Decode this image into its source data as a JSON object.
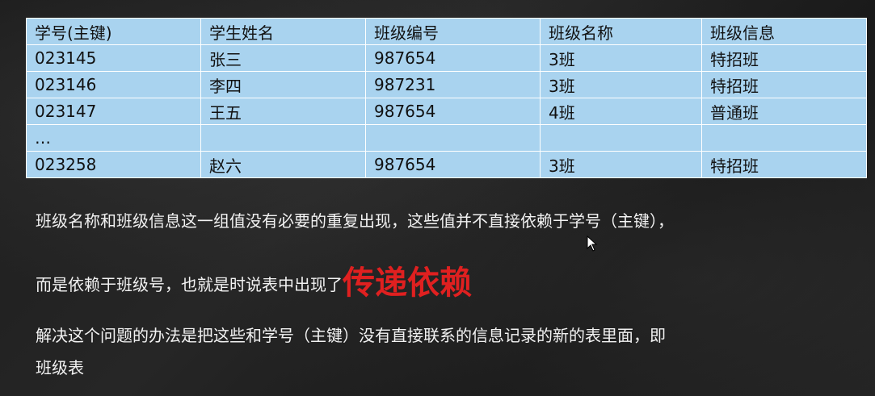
{
  "table": {
    "headers": [
      "学号(主键)",
      "学生姓名",
      "班级编号",
      "班级名称",
      "班级信息"
    ],
    "rows": [
      [
        "023145",
        "张三",
        "987654",
        "3班",
        "特招班"
      ],
      [
        "023146",
        "李四",
        "987231",
        "3班",
        "特招班"
      ],
      [
        "023147",
        "王五",
        "987654",
        "4班",
        "普通班"
      ],
      [
        "…",
        "",
        "",
        "",
        ""
      ],
      [
        "023258",
        "赵六",
        "987654",
        "3班",
        "特招班"
      ]
    ]
  },
  "text": {
    "line1": "班级名称和班级信息这一组值没有必要的重复出现，这些值并不直接依赖于学号（主键），",
    "line2_prefix": "而是依赖于班级号，也就是时说表中出现了",
    "line2_highlight": "传递依赖",
    "line3": "解决这个问题的办法是把这些和学号（主键）没有直接联系的信息记录的新的表里面，即",
    "line4": "班级表"
  },
  "colors": {
    "table_cell_bg": "#a9d3ef",
    "highlight_text": "#e02020",
    "body_text": "#f2f2f2",
    "background": "#1f1f1f"
  }
}
